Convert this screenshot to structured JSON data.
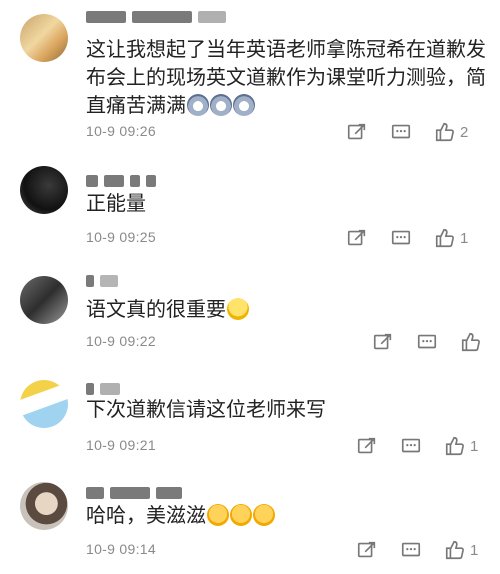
{
  "comments": [
    {
      "text": "这让我想起了当年英语老师拿陈冠希在道歉发布会上的现场英文道歉作为课堂听力测验，简直痛苦满满",
      "emoji": [
        "dog-face-icon",
        "dog-face-icon",
        "dog-face-icon"
      ],
      "time": "10-9 09:26",
      "likes": "2"
    },
    {
      "text": "正能量",
      "emoji": [],
      "time": "10-9 09:25",
      "likes": "1"
    },
    {
      "text": "语文真的很重要",
      "emoji": [
        "laughing-tears-icon"
      ],
      "time": "10-9 09:22",
      "likes": ""
    },
    {
      "text": "下次道歉信请这位老师来写",
      "emoji": [],
      "time": "10-9 09:21",
      "likes": "1"
    },
    {
      "text": "哈哈，美滋滋",
      "emoji": [
        "shy-smile-icon",
        "shy-smile-icon",
        "shy-smile-icon"
      ],
      "time": "10-9 09:14",
      "likes": "1"
    }
  ],
  "icons": {
    "share": "share-icon",
    "comment": "comment-icon",
    "like": "thumbs-up-icon"
  },
  "colors": {
    "meta_text": "#8a8a8a",
    "body_text": "#222222"
  }
}
